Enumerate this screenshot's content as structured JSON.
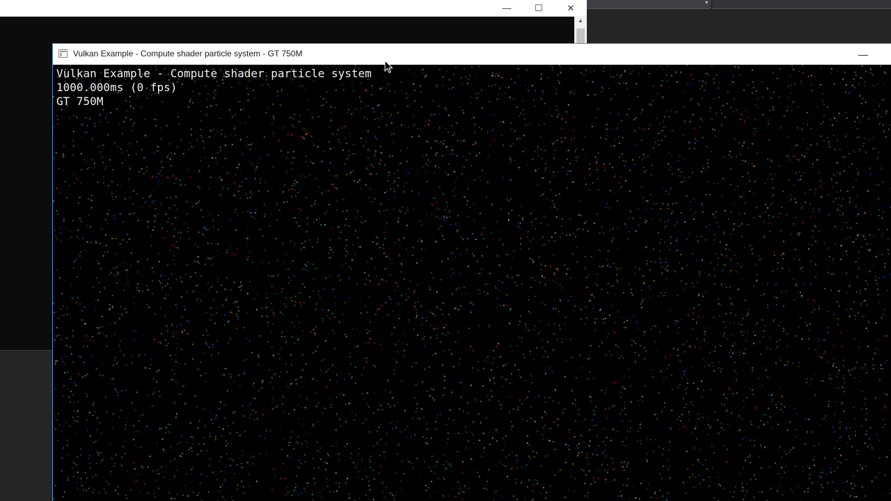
{
  "ide": {
    "combo_arrow": "▾"
  },
  "console_window": {
    "buttons": {
      "minimize": "—",
      "maximize": "☐",
      "close": "✕"
    },
    "scroll_up": "▲"
  },
  "vulkan_window": {
    "title": "Vulkan Example - Compute shader particle system - GT 750M",
    "minimize": "—",
    "overlay": {
      "line1": "Vulkan Example - Compute shader particle system",
      "line2": "1000.000ms (0 fps)",
      "line3": "GT 750M"
    },
    "particle_colors": [
      "#3fd23f",
      "#e8e8e8",
      "#ff3030",
      "#3060ff",
      "#ffa020",
      "#40c0ff"
    ]
  },
  "colors": {
    "accent_border": "#4a90d9",
    "canvas_bg": "#000000",
    "ide_bg": "#252526"
  }
}
